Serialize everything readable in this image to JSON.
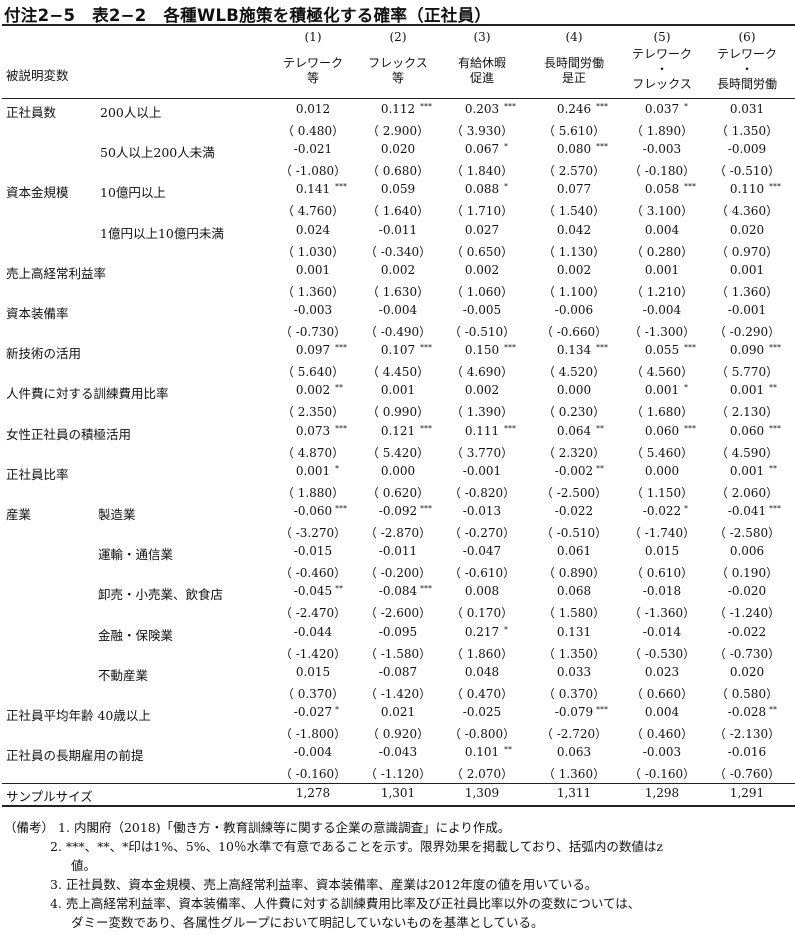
{
  "title": "付注2−5　表2−2　各種WLB施策を積極化する確率（正社員）",
  "variable_header": "被説明変数",
  "columns": [
    {
      "num": "(1)",
      "label": [
        "テレワーク",
        "等"
      ]
    },
    {
      "num": "(2)",
      "label": [
        "フレックス",
        "等"
      ]
    },
    {
      "num": "(3)",
      "label": [
        "有給休暇",
        "促進"
      ]
    },
    {
      "num": "(4)",
      "label": [
        "長時間労働",
        "是正"
      ]
    },
    {
      "num": "(5)",
      "label": [
        "テレワーク",
        "・",
        "フレックス"
      ]
    },
    {
      "num": "(6)",
      "label": [
        "テレワーク",
        "・",
        "長時間労働"
      ]
    }
  ],
  "rows": [
    {
      "group": "正社員数",
      "sub": "200人以上",
      "coef": [
        "0.012",
        "0.112",
        "0.203",
        "0.246",
        "0.037",
        "0.031"
      ],
      "stars": [
        "",
        "***",
        "***",
        "***",
        "*",
        ""
      ],
      "z": [
        "0.480",
        "2.900",
        "3.930",
        "5.610",
        "1.890",
        "1.350"
      ]
    },
    {
      "group": "",
      "sub": "50人以上200人未満",
      "coef": [
        "-0.021",
        "0.020",
        "0.067",
        "0.080",
        "-0.003",
        "-0.009"
      ],
      "stars": [
        "",
        "",
        "*",
        "***",
        "",
        ""
      ],
      "z": [
        "-1.080",
        "0.680",
        "1.840",
        "2.570",
        "-0.180",
        "-0.510"
      ]
    },
    {
      "group": "資本金規模",
      "sub": "10億円以上",
      "coef": [
        "0.141",
        "0.059",
        "0.088",
        "0.077",
        "0.058",
        "0.110"
      ],
      "stars": [
        "***",
        "",
        "*",
        "",
        "***",
        "***"
      ],
      "z": [
        "4.760",
        "1.640",
        "1.710",
        "1.540",
        "3.100",
        "4.360"
      ]
    },
    {
      "group": "",
      "sub": "1億円以上10億円未満",
      "coef": [
        "0.024",
        "-0.011",
        "0.027",
        "0.042",
        "0.004",
        "0.020"
      ],
      "stars": [
        "",
        "",
        "",
        "",
        "",
        ""
      ],
      "z": [
        "1.030",
        "-0.340",
        "0.650",
        "1.130",
        "0.280",
        "0.970"
      ]
    },
    {
      "group": "売上高経常利益率",
      "sub": "",
      "coef": [
        "0.001",
        "0.002",
        "0.002",
        "0.002",
        "0.001",
        "0.001"
      ],
      "stars": [
        "",
        "",
        "",
        "",
        "",
        ""
      ],
      "z": [
        "1.360",
        "1.630",
        "1.060",
        "1.100",
        "1.210",
        "1.360"
      ]
    },
    {
      "group": "資本装備率",
      "sub": "",
      "coef": [
        "-0.003",
        "-0.004",
        "-0.005",
        "-0.006",
        "-0.004",
        "-0.001"
      ],
      "stars": [
        "",
        "",
        "",
        "",
        "",
        ""
      ],
      "z": [
        "-0.730",
        "-0.490",
        "-0.510",
        "-0.660",
        "-1.300",
        "-0.290"
      ]
    },
    {
      "group": "新技術の活用",
      "sub": "",
      "coef": [
        "0.097",
        "0.107",
        "0.150",
        "0.134",
        "0.055",
        "0.090"
      ],
      "stars": [
        "***",
        "***",
        "***",
        "***",
        "***",
        "***"
      ],
      "z": [
        "5.640",
        "4.450",
        "4.690",
        "4.520",
        "4.560",
        "5.770"
      ]
    },
    {
      "group": "人件費に対する訓練費用比率",
      "sub": "",
      "coef": [
        "0.002",
        "0.001",
        "0.002",
        "0.000",
        "0.001",
        "0.001"
      ],
      "stars": [
        "**",
        "",
        "",
        "",
        "*",
        "**"
      ],
      "z": [
        "2.350",
        "0.990",
        "1.390",
        "0.230",
        "1.680",
        "2.130"
      ]
    },
    {
      "group": "女性正社員の積極活用",
      "sub": "",
      "coef": [
        "0.073",
        "0.121",
        "0.111",
        "0.064",
        "0.060",
        "0.060"
      ],
      "stars": [
        "***",
        "***",
        "***",
        "**",
        "***",
        "***"
      ],
      "z": [
        "4.870",
        "5.420",
        "3.770",
        "2.320",
        "5.460",
        "4.590"
      ]
    },
    {
      "group": "正社員比率",
      "sub": "",
      "coef": [
        "0.001",
        "0.000",
        "-0.001",
        "-0.002",
        "0.000",
        "0.001"
      ],
      "stars": [
        "*",
        "",
        "",
        "**",
        "",
        "**"
      ],
      "z": [
        "1.880",
        "0.620",
        "-0.820",
        "-2.500",
        "1.150",
        "2.060"
      ]
    },
    {
      "group": "産業",
      "sub": "製造業",
      "coef": [
        "-0.060",
        "-0.092",
        "-0.013",
        "-0.022",
        "-0.022",
        "-0.041"
      ],
      "stars": [
        "***",
        "***",
        "",
        "",
        "*",
        "***"
      ],
      "z": [
        "-3.270",
        "-2.870",
        "-0.270",
        "-0.510",
        "-1.740",
        "-2.580"
      ]
    },
    {
      "group": "",
      "sub": "運輸・通信業",
      "coef": [
        "-0.015",
        "-0.011",
        "-0.047",
        "0.061",
        "0.015",
        "0.006"
      ],
      "stars": [
        "",
        "",
        "",
        "",
        "",
        ""
      ],
      "z": [
        "-0.460",
        "-0.200",
        "-0.610",
        "0.890",
        "0.610",
        "0.190"
      ]
    },
    {
      "group": "",
      "sub": "卸売・小売業、飲食店",
      "coef": [
        "-0.045",
        "-0.084",
        "0.008",
        "0.068",
        "-0.018",
        "-0.020"
      ],
      "stars": [
        "**",
        "***",
        "",
        "",
        "",
        ""
      ],
      "z": [
        "-2.470",
        "-2.600",
        "0.170",
        "1.580",
        "-1.360",
        "-1.240"
      ]
    },
    {
      "group": "",
      "sub": "金融・保険業",
      "coef": [
        "-0.044",
        "-0.095",
        "0.217",
        "0.131",
        "-0.014",
        "-0.022"
      ],
      "stars": [
        "",
        "",
        "*",
        "",
        "",
        ""
      ],
      "z": [
        "-1.420",
        "-1.580",
        "1.860",
        "1.350",
        "-0.530",
        "-0.730"
      ]
    },
    {
      "group": "",
      "sub": "不動産業",
      "coef": [
        "0.015",
        "-0.087",
        "0.048",
        "0.033",
        "0.023",
        "0.020"
      ],
      "stars": [
        "",
        "",
        "",
        "",
        "",
        ""
      ],
      "z": [
        "0.370",
        "-1.420",
        "0.470",
        "0.370",
        "0.660",
        "0.580"
      ]
    },
    {
      "group": "正社員平均年齢 40歳以上",
      "sub": "",
      "coef": [
        "-0.027",
        "0.021",
        "-0.025",
        "-0.079",
        "0.004",
        "-0.028"
      ],
      "stars": [
        "*",
        "",
        "",
        "***",
        "",
        "**"
      ],
      "z": [
        "-1.800",
        "0.920",
        "-0.800",
        "-2.720",
        "0.460",
        "-2.130"
      ]
    },
    {
      "group": "正社員の長期雇用の前提",
      "sub": "",
      "coef": [
        "-0.004",
        "-0.043",
        "0.101",
        "0.063",
        "-0.003",
        "-0.016"
      ],
      "stars": [
        "",
        "",
        "**",
        "",
        "",
        ""
      ],
      "z": [
        "-0.160",
        "-1.120",
        "2.070",
        "1.360",
        "-0.160",
        "-0.760"
      ]
    }
  ],
  "sample_size": {
    "label": "サンプルサイズ",
    "values": [
      "1,278",
      "1,301",
      "1,309",
      "1,311",
      "1,298",
      "1,291"
    ]
  },
  "notes": {
    "prefix": "（備考）",
    "items": [
      {
        "num": "1.",
        "text": "内閣府（2018)「働き方・教育訓練等に関する企業の意識調査」により作成。"
      },
      {
        "num": "2.",
        "text": "***、**、*印は1%、5%、10％水準で有意であることを示す。限界効果を掲載しており、括弧内の数値はz",
        "cont": "値。"
      },
      {
        "num": "3.",
        "text": "正社員数、資本金規模、売上高経常利益率、資本装備率、産業は2012年度の値を用いている。"
      },
      {
        "num": "4.",
        "text": "売上高経常利益率、資本装備率、人件費に対する訓練費用比率及び正社員比率以外の変数については、",
        "cont": "ダミー変数であり、各属性グループにおいて明記していないものを基準としている。"
      }
    ]
  }
}
